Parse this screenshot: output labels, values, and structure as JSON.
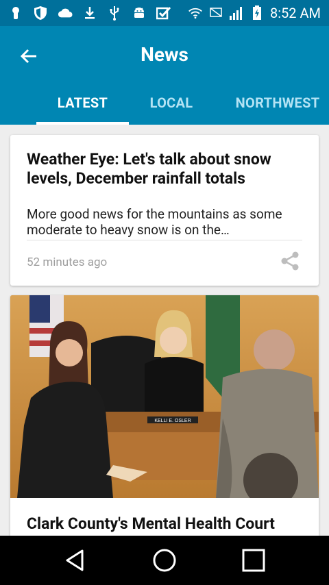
{
  "status_bar": {
    "time": "8:52 AM",
    "icons": [
      "location-pin-icon",
      "shield-icon",
      "cloud-icon",
      "download-icon",
      "usb-icon",
      "android-icon",
      "checkbox-icon",
      "wifi-icon",
      "no-sim-icon",
      "signal-icon",
      "battery-charging-icon"
    ]
  },
  "app_bar": {
    "title": "News",
    "back_icon": "arrow-left-icon"
  },
  "tabs": [
    {
      "label": "LATEST",
      "active": true
    },
    {
      "label": "LOCAL",
      "active": false
    },
    {
      "label": "NORTHWEST",
      "active": false
    }
  ],
  "articles": [
    {
      "headline": "Weather Eye: Let's talk about snow levels, December rainfall totals",
      "summary": "More good news for the mountains as some moderate to heavy snow is on the…",
      "time": "52 minutes ago",
      "share_icon": "share-icon"
    },
    {
      "image": "courtroom-photo",
      "nameplate": "KELLI E. OSLER",
      "headline": "Clark County's Mental Health Court"
    }
  ],
  "nav_bar": {
    "back": "nav-back-icon",
    "home": "nav-home-icon",
    "recents": "nav-recents-icon"
  },
  "colors": {
    "status_bar": "#00709b",
    "app_bar": "#0086b3",
    "inactive_tab": "#b3e3f4",
    "background": "#eeeeee"
  }
}
